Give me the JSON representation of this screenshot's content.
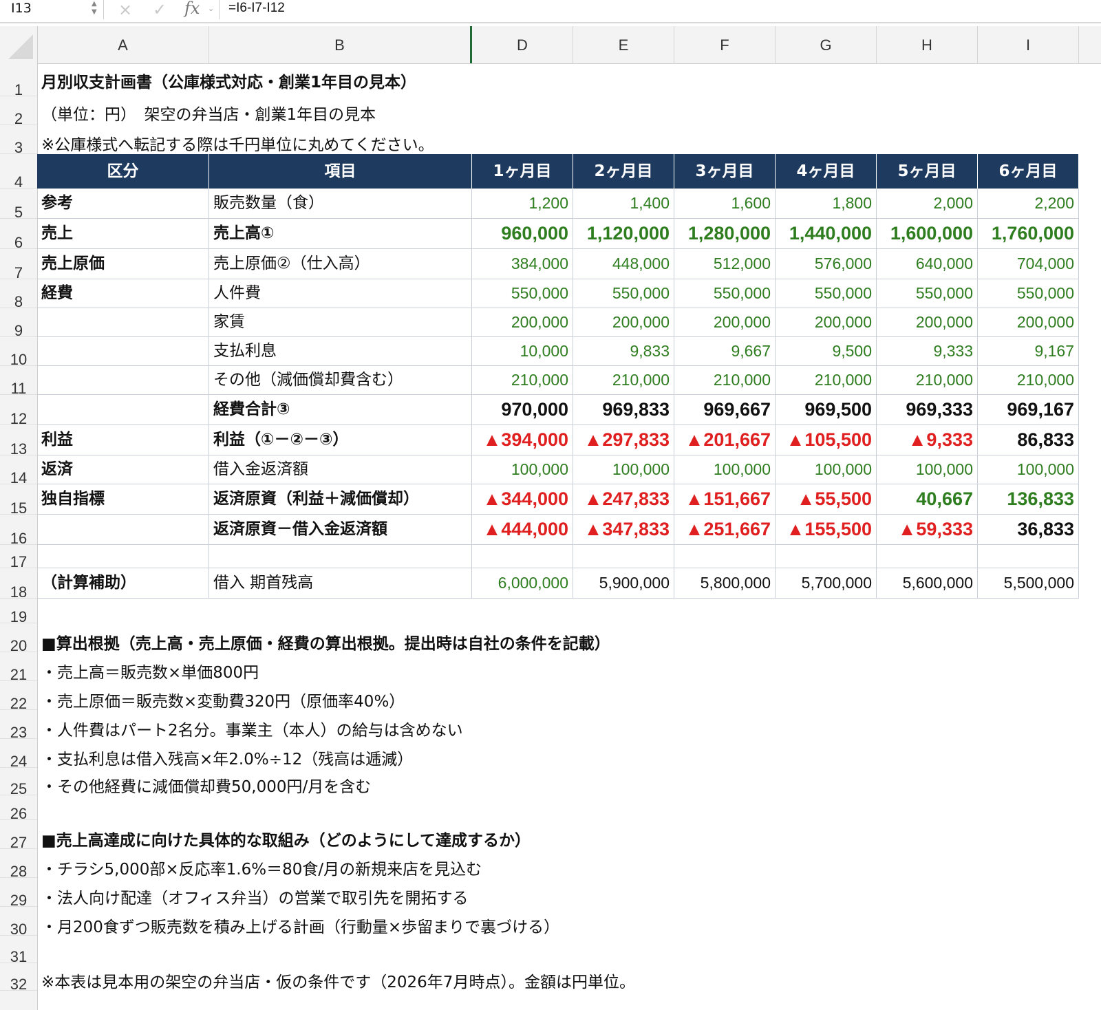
{
  "formula_bar": {
    "name_box": "I13",
    "cancel_icon": "×",
    "confirm_icon": "✓",
    "fx_label": "fx",
    "formula": "=I6-I7-I12"
  },
  "columns": [
    "A",
    "B",
    "D",
    "E",
    "F",
    "G",
    "H",
    "I"
  ],
  "row_numbers": [
    "1",
    "2",
    "3",
    "4",
    "5",
    "6",
    "7",
    "8",
    "9",
    "10",
    "11",
    "12",
    "13",
    "14",
    "15",
    "16",
    "17",
    "18",
    "19",
    "20",
    "21",
    "22",
    "23",
    "24",
    "25",
    "26",
    "27",
    "28",
    "29",
    "30",
    "31",
    "32"
  ],
  "title": "月別収支計画書（公庫様式対応・創業1年目の見本）",
  "subtitle": "（単位：円）　架空の弁当店・創業1年目の見本",
  "note_top": "※公庫様式へ転記する際は千円単位に丸めてください。",
  "table_header": [
    "区分",
    "項目",
    "1ヶ月目",
    "2ヶ月目",
    "3ヶ月目",
    "4ヶ月目",
    "5ヶ月目",
    "6ヶ月目"
  ],
  "rows": [
    {
      "category": "参考",
      "item": "販売数量（食）",
      "values": [
        "1,200",
        "1,400",
        "1,600",
        "1,800",
        "2,000",
        "2,200"
      ]
    },
    {
      "category": "売上",
      "item": "売上高①",
      "values": [
        "960,000",
        "1,120,000",
        "1,280,000",
        "1,440,000",
        "1,600,000",
        "1,760,000"
      ]
    },
    {
      "category": "売上原価",
      "item": "売上原価②（仕入高）",
      "values": [
        "384,000",
        "448,000",
        "512,000",
        "576,000",
        "640,000",
        "704,000"
      ]
    },
    {
      "category": "経費",
      "item": "人件費",
      "values": [
        "550,000",
        "550,000",
        "550,000",
        "550,000",
        "550,000",
        "550,000"
      ]
    },
    {
      "category": "",
      "item": "家賃",
      "values": [
        "200,000",
        "200,000",
        "200,000",
        "200,000",
        "200,000",
        "200,000"
      ]
    },
    {
      "category": "",
      "item": "支払利息",
      "values": [
        "10,000",
        "9,833",
        "9,667",
        "9,500",
        "9,333",
        "9,167"
      ]
    },
    {
      "category": "",
      "item": "その他（減価償却費含む）",
      "values": [
        "210,000",
        "210,000",
        "210,000",
        "210,000",
        "210,000",
        "210,000"
      ]
    },
    {
      "category": "",
      "item": "経費合計③",
      "values": [
        "970,000",
        "969,833",
        "969,667",
        "969,500",
        "969,333",
        "969,167"
      ]
    },
    {
      "category": "利益",
      "item": "利益（①－②－③）",
      "values": [
        "▲394,000",
        "▲297,833",
        "▲201,667",
        "▲105,500",
        "▲9,333",
        "86,833"
      ]
    },
    {
      "category": "返済",
      "item": "借入金返済額",
      "values": [
        "100,000",
        "100,000",
        "100,000",
        "100,000",
        "100,000",
        "100,000"
      ]
    },
    {
      "category": "独自指標",
      "item": "返済原資（利益＋減価償却）",
      "values": [
        "▲344,000",
        "▲247,833",
        "▲151,667",
        "▲55,500",
        "40,667",
        "136,833"
      ]
    },
    {
      "category": "",
      "item": "返済原資－借入金返済額",
      "values": [
        "▲444,000",
        "▲347,833",
        "▲251,667",
        "▲155,500",
        "▲59,333",
        "36,833"
      ]
    },
    {
      "category": "",
      "item": "",
      "values": [
        "",
        "",
        "",
        "",
        "",
        ""
      ]
    },
    {
      "category": "（計算補助）",
      "item": "借入 期首残高",
      "values": [
        "6,000,000",
        "5,900,000",
        "5,800,000",
        "5,700,000",
        "5,600,000",
        "5,500,000"
      ]
    }
  ],
  "notes": {
    "basis_heading": "■算出根拠（売上高・売上原価・経費の算出根拠。提出時は自社の条件を記載）",
    "basis_items": [
      "・売上高＝販売数×単価800円",
      "・売上原価＝販売数×変動費320円（原価率40%）",
      "・人件費はパート2名分。事業主（本人）の給与は含めない",
      "・支払利息は借入残高×年2.0%÷12（残高は逓減）",
      "・その他経費に減価償却費50,000円/月を含む"
    ],
    "plan_heading": "■売上高達成に向けた具体的な取組み（どのようにして達成するか）",
    "plan_items": [
      "・チラシ5,000部×反応率1.6%＝80食/月の新規来店を見込む",
      "・法人向け配達（オフィス弁当）の営業で取引先を開拓する",
      "・月200食ずつ販売数を積み上げる計画（行動量×歩留まりで裏づける）"
    ],
    "footer": "※本表は見本用の架空の弁当店・仮の条件です（2026年7月時点）。金額は円単位。"
  },
  "colors": {
    "header_bg": "#1f3a5f",
    "input_green": "#2e7d1f",
    "negative_red": "#e02020",
    "selection_green": "#1e6b35"
  }
}
